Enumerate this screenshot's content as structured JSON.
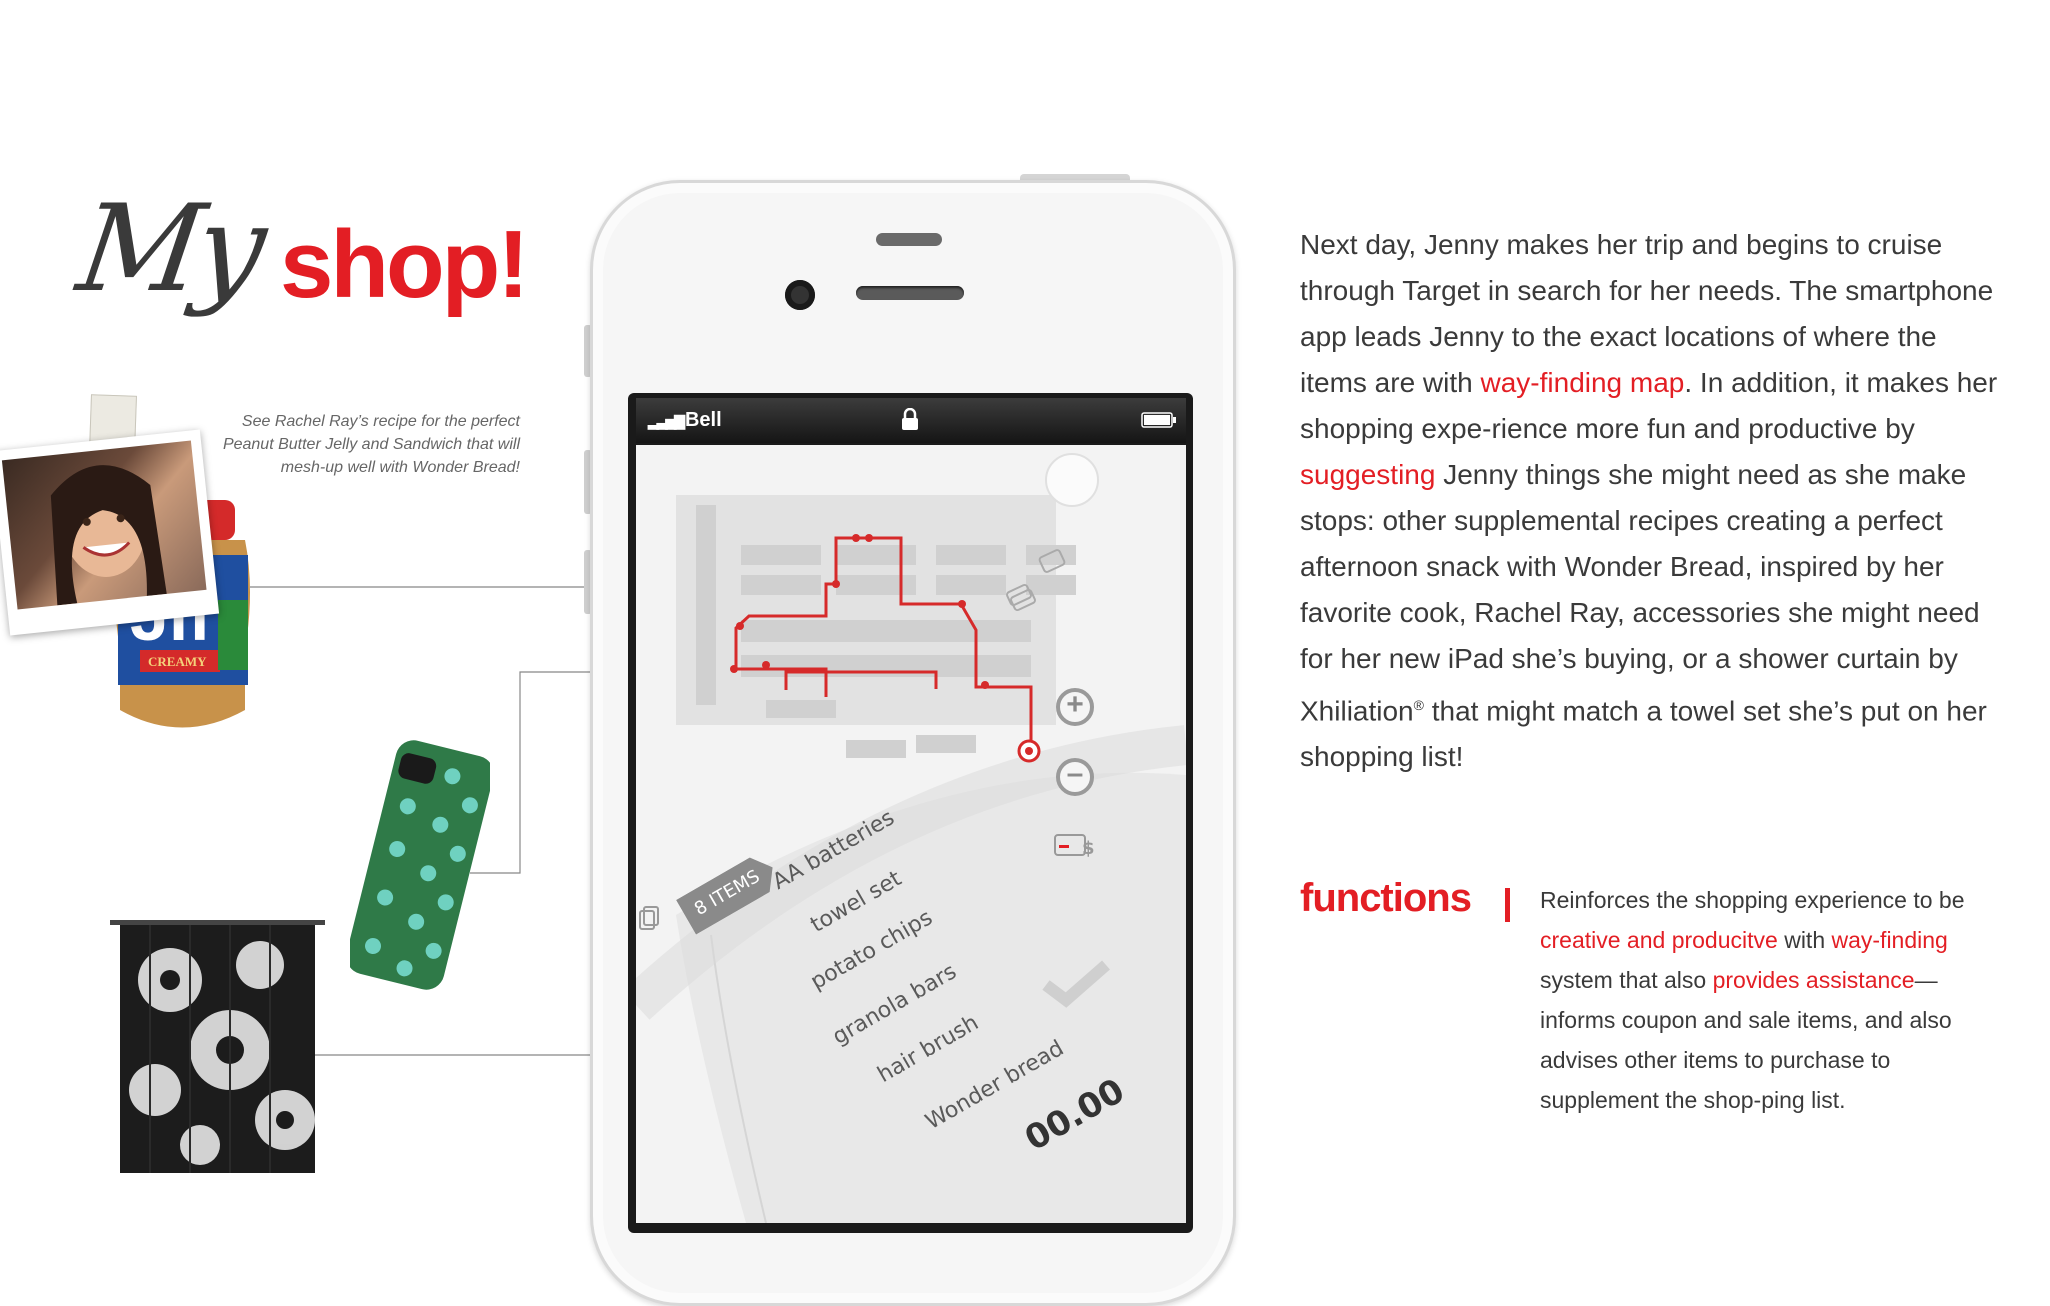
{
  "title": {
    "my": "My",
    "shop": "shop!"
  },
  "caption": "See Rachel Ray’s recipe for the perfect Peanut Butter Jelly and Sandwich that will mesh-up well with Wonder Bread!",
  "phone": {
    "carrier": "Bell",
    "items_badge": "8 ITEMS",
    "list": [
      "AA batteries",
      "towel set",
      "potato chips",
      "granola bars",
      "hair brush",
      "Wonder bread"
    ],
    "total": "00.00"
  },
  "story": {
    "p1": "Next day, Jenny makes her trip and begins to cruise through Target in search for her needs. The smartphone app leads Jenny to the exact locations of where the items are with ",
    "link1": "way-finding map",
    "p2": ". In addition, it makes her shopping expe-rience more fun and productive by ",
    "link2": "suggesting",
    "p3": " Jenny things she might need as she make stops: other supplemental recipes creating a perfect afternoon snack with Wonder Bread, inspired by her favorite cook, Rachel Ray, accessories she might need for her new iPad she’s buying, or a shower curtain by Xhiliation",
    "reg": "®",
    "p4": " that might match a towel set she’s put on her shopping list!"
  },
  "functions": {
    "label": "functions",
    "t1": "Reinforces the shopping experience to be ",
    "h1": "creative and producitve",
    "t2": " with ",
    "h2": "way-finding",
    "t3": " system that also ",
    "h3": "provides assistance",
    "t4": "—informs coupon and sale items, and also advises other items to purchase to supplement the shop-ping list."
  },
  "colors": {
    "accent": "#e31e24",
    "text": "#3a3a3a",
    "route": "#d62a2a"
  },
  "icons": [
    "lock-icon",
    "battery-icon",
    "signal-icon",
    "compass-icon",
    "coupon-icon",
    "tag-icon",
    "zoom-in-icon",
    "zoom-out-icon",
    "payment-icon",
    "target-marker-icon",
    "list-icon"
  ]
}
